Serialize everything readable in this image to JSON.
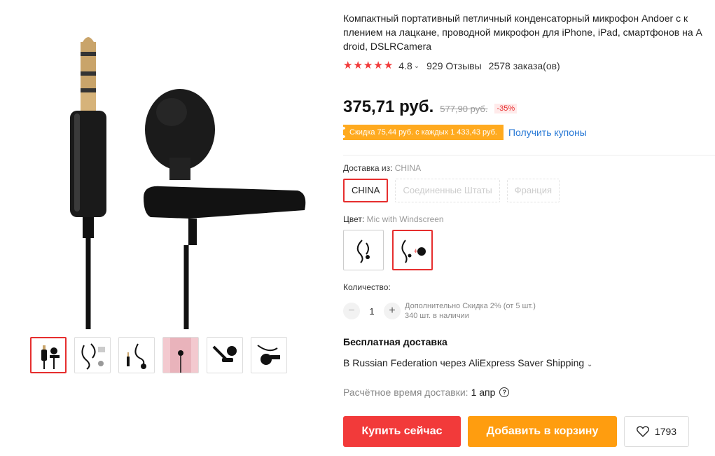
{
  "product": {
    "title": "Компактный портативный петличный конденсаторный микрофон Andoer с к\nплением на лацкане, проводной микрофон для iPhone, iPad, смартфонов на A\ndroid, DSLRCamera",
    "rating": "4.8",
    "reviews": "929 Отзывы",
    "orders": "2578 заказа(ов)",
    "stars": 5
  },
  "price": {
    "current": "375,71 руб.",
    "original": "577,90 руб.",
    "discount": "-35%"
  },
  "coupon": {
    "text": "Скидка 75,44 руб. с каждых 1 433,43 руб.",
    "link": "Получить купоны"
  },
  "shipping_from": {
    "label": "Доставка из:",
    "value": "CHINA",
    "options": [
      "CHINA",
      "Соединенные Штаты",
      "Франция"
    ]
  },
  "color": {
    "label": "Цвет:",
    "value": "Mic with Windscreen"
  },
  "quantity": {
    "label": "Количество:",
    "value": "1",
    "minus": "−",
    "plus": "+",
    "extra_discount": "Дополнительно Скидка 2% (от 5 шт.)",
    "stock": "340 шт. в наличии"
  },
  "delivery": {
    "free": "Бесплатная доставка",
    "via": "В Russian Federation через AliExpress Saver Shipping",
    "eta_label": "Расчётное время доставки:",
    "eta_date": "1 апр"
  },
  "actions": {
    "buy": "Купить сейчас",
    "cart": "Добавить в корзину",
    "wishlist_count": "1793"
  },
  "colors": {
    "accent_red": "#f23a3a",
    "accent_orange": "#ff9d0f",
    "coupon_orange": "#ffaa1f",
    "link_blue": "#2a7ad6"
  }
}
